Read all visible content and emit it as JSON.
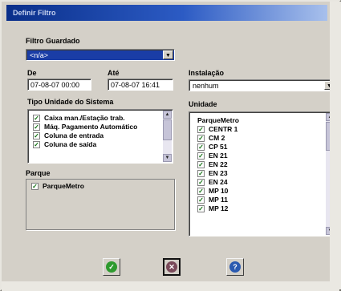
{
  "window": {
    "title": "Definir Filtro"
  },
  "saved_filter": {
    "label": "Filtro Guardado",
    "value": "<n/a>"
  },
  "date_from": {
    "label": "De",
    "value": "07-08-07 00:00"
  },
  "date_to": {
    "label": "Até",
    "value": "07-08-07 16:41"
  },
  "installation": {
    "label": "Instalação",
    "value": "nenhum"
  },
  "unit_type": {
    "label": "Tipo Unidade do Sistema",
    "items": [
      "Caixa man./Estação trab.",
      "Máq. Pagamento Automático",
      "Coluna de entrada",
      "Coluna de saída"
    ]
  },
  "park": {
    "label": "Parque",
    "items": [
      "ParqueMetro"
    ]
  },
  "unit": {
    "label": "Unidade",
    "header": "ParqueMetro",
    "items": [
      "CENTR 1",
      "CM 2",
      "CP 51",
      "EN 21",
      "EN 22",
      "EN 23",
      "EN 24",
      "MP 10",
      "MP 11",
      "MP 12"
    ]
  },
  "buttons": {
    "ok_icon": "checkmark-icon",
    "cancel_icon": "close-icon",
    "help_icon": "help-icon"
  },
  "colors": {
    "titlebar": "#0a2f8a",
    "selection": "#1a3da6",
    "ok": "#2e9a2e",
    "cancel": "#7a4a5a",
    "help": "#2a5ab0"
  }
}
